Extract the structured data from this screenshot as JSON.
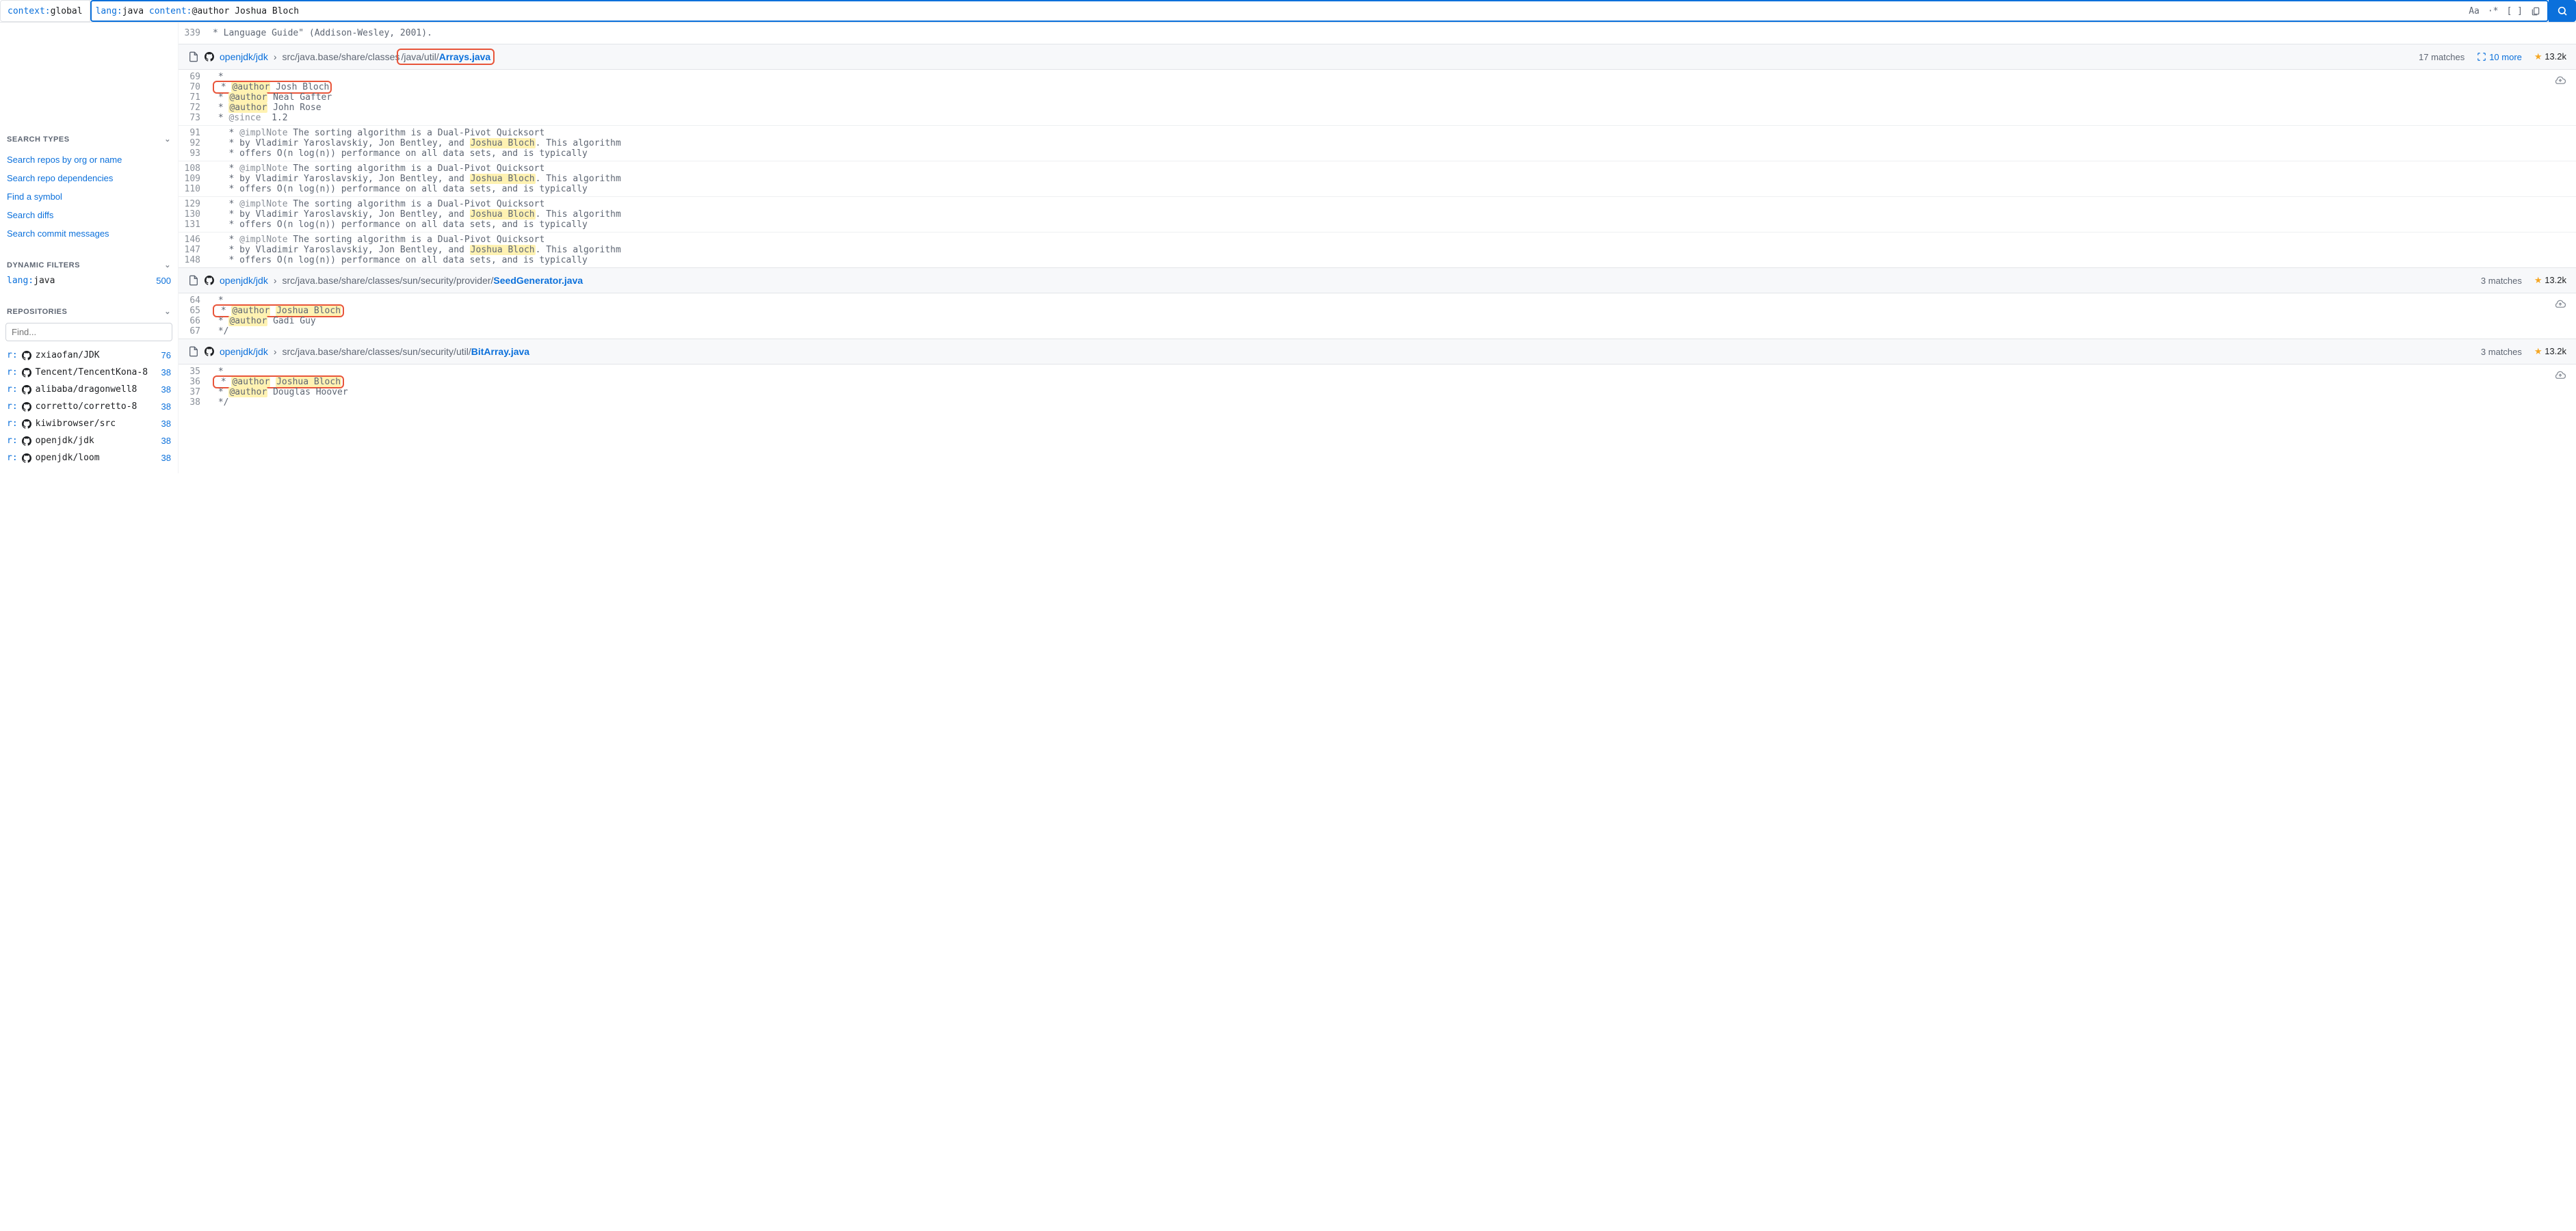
{
  "search": {
    "context_key": "context:",
    "context_val": "global",
    "query_parts": [
      {
        "k": "lang:",
        "v": "java "
      },
      {
        "k": "content:",
        "v": "@author Joshua Bloch"
      }
    ],
    "icons": {
      "case": "Aa",
      "regex": "·*",
      "struct": "[ ]",
      "clip": "📋"
    }
  },
  "sidebar": {
    "search_types": {
      "title": "Search Types",
      "links": [
        "Search repos by org or name",
        "Search repo dependencies",
        "Find a symbol",
        "Search diffs",
        "Search commit messages"
      ]
    },
    "dynamic_filters": {
      "title": "Dynamic Filters",
      "items": [
        {
          "key": "lang:",
          "val": "java",
          "count": "500"
        }
      ]
    },
    "repositories": {
      "title": "Repositories",
      "find_placeholder": "Find...",
      "items": [
        {
          "prefix": "r:",
          "name": "zxiaofan/JDK",
          "count": "76"
        },
        {
          "prefix": "r:",
          "name": "Tencent/TencentKona-8",
          "count": "38"
        },
        {
          "prefix": "r:",
          "name": "alibaba/dragonwell8",
          "count": "38"
        },
        {
          "prefix": "r:",
          "name": "corretto/corretto-8",
          "count": "38"
        },
        {
          "prefix": "r:",
          "name": "kiwibrowser/src",
          "count": "38"
        },
        {
          "prefix": "r:",
          "name": "openjdk/jdk",
          "count": "38"
        },
        {
          "prefix": "r:",
          "name": "openjdk/loom",
          "count": "38"
        }
      ]
    }
  },
  "trunc_prev": {
    "num": "339",
    "text": " * Language Guide\"  (Addison-Wesley, 2001)."
  },
  "results": [
    {
      "repo": "openjdk/jdk",
      "path": "src/java.base/share/classes",
      "path_boxed": "/java/util/",
      "file": "Arrays.java",
      "file_redbox": true,
      "matches": "17 matches",
      "more": "10 more",
      "stars": "13.2k",
      "hunks": [
        {
          "cloud": true,
          "lines": [
            {
              "n": "69",
              "segs": [
                {
                  "t": " *"
                }
              ]
            },
            {
              "n": "70",
              "redbox": true,
              "segs": [
                {
                  "t": " * "
                },
                {
                  "t": "@author",
                  "hl": true
                },
                {
                  "t": " Josh Bloch"
                }
              ]
            },
            {
              "n": "71",
              "segs": [
                {
                  "t": " * "
                },
                {
                  "t": "@author",
                  "hl": true
                },
                {
                  "t": " Neal Gafter"
                }
              ]
            },
            {
              "n": "72",
              "segs": [
                {
                  "t": " * "
                },
                {
                  "t": "@author",
                  "hl": true
                },
                {
                  "t": " John Rose"
                }
              ]
            },
            {
              "n": "73",
              "segs": [
                {
                  "t": " * "
                },
                {
                  "t": "@since",
                  "cls": "anno-tag"
                },
                {
                  "t": "  1.2"
                }
              ]
            }
          ]
        },
        {
          "lines": [
            {
              "n": "91",
              "segs": [
                {
                  "t": "   * "
                },
                {
                  "t": "@implNote",
                  "cls": "anno-tag"
                },
                {
                  "t": " The sorting algorithm is a Dual-Pivot Quicksort"
                }
              ]
            },
            {
              "n": "92",
              "segs": [
                {
                  "t": "   * by Vladimir Yaroslavskiy, Jon Bentley, and "
                },
                {
                  "t": "Joshua Bloch",
                  "hl": true
                },
                {
                  "t": ". This algorithm"
                }
              ]
            },
            {
              "n": "93",
              "segs": [
                {
                  "t": "   * offers O(n log(n)) performance on all data sets, and is typically"
                }
              ]
            }
          ]
        },
        {
          "lines": [
            {
              "n": "108",
              "segs": [
                {
                  "t": "   * "
                },
                {
                  "t": "@implNote",
                  "cls": "anno-tag"
                },
                {
                  "t": " The sorting algorithm is a Dual-Pivot Quicksort"
                }
              ]
            },
            {
              "n": "109",
              "segs": [
                {
                  "t": "   * by Vladimir Yaroslavskiy, Jon Bentley, and "
                },
                {
                  "t": "Joshua Bloch",
                  "hl": true
                },
                {
                  "t": ". This algorithm"
                }
              ]
            },
            {
              "n": "110",
              "segs": [
                {
                  "t": "   * offers O(n log(n)) performance on all data sets, and is typically"
                }
              ]
            }
          ]
        },
        {
          "lines": [
            {
              "n": "129",
              "segs": [
                {
                  "t": "   * "
                },
                {
                  "t": "@implNote",
                  "cls": "anno-tag"
                },
                {
                  "t": " The sorting algorithm is a Dual-Pivot Quicksort"
                }
              ]
            },
            {
              "n": "130",
              "segs": [
                {
                  "t": "   * by Vladimir Yaroslavskiy, Jon Bentley, and "
                },
                {
                  "t": "Joshua Bloch",
                  "hl": true
                },
                {
                  "t": ". This algorithm"
                }
              ]
            },
            {
              "n": "131",
              "segs": [
                {
                  "t": "   * offers O(n log(n)) performance on all data sets, and is typically"
                }
              ]
            }
          ]
        },
        {
          "lines": [
            {
              "n": "146",
              "segs": [
                {
                  "t": "   * "
                },
                {
                  "t": "@implNote",
                  "cls": "anno-tag"
                },
                {
                  "t": " The sorting algorithm is a Dual-Pivot Quicksort"
                }
              ]
            },
            {
              "n": "147",
              "segs": [
                {
                  "t": "   * by Vladimir Yaroslavskiy, Jon Bentley, and "
                },
                {
                  "t": "Joshua Bloch",
                  "hl": true
                },
                {
                  "t": ". This algorithm"
                }
              ]
            },
            {
              "n": "148",
              "segs": [
                {
                  "t": "   * offers O(n log(n)) performance on all data sets, and is typically"
                }
              ]
            }
          ]
        }
      ]
    },
    {
      "repo": "openjdk/jdk",
      "path": "src/java.base/share/classes/sun/security/provider/",
      "file": "SeedGenerator.java",
      "matches": "3 matches",
      "stars": "13.2k",
      "hunks": [
        {
          "cloud": true,
          "lines": [
            {
              "n": "64",
              "segs": [
                {
                  "t": " *"
                }
              ]
            },
            {
              "n": "65",
              "redbox": true,
              "segs": [
                {
                  "t": " * "
                },
                {
                  "t": "@author",
                  "hl": true
                },
                {
                  "t": " "
                },
                {
                  "t": "Joshua Bloch",
                  "hl": true
                }
              ]
            },
            {
              "n": "66",
              "segs": [
                {
                  "t": " * "
                },
                {
                  "t": "@author",
                  "hl": true
                },
                {
                  "t": " Gadi Guy"
                }
              ]
            },
            {
              "n": "67",
              "segs": [
                {
                  "t": " */"
                }
              ]
            }
          ]
        }
      ]
    },
    {
      "repo": "openjdk/jdk",
      "path": "src/java.base/share/classes/sun/security/util/",
      "file": "BitArray.java",
      "matches": "3 matches",
      "stars": "13.2k",
      "hunks": [
        {
          "cloud": true,
          "lines": [
            {
              "n": "35",
              "segs": [
                {
                  "t": " *"
                }
              ]
            },
            {
              "n": "36",
              "redbox": true,
              "segs": [
                {
                  "t": " * "
                },
                {
                  "t": "@author",
                  "hl": true
                },
                {
                  "t": " "
                },
                {
                  "t": "Joshua Bloch",
                  "hl": true
                }
              ]
            },
            {
              "n": "37",
              "segs": [
                {
                  "t": " * "
                },
                {
                  "t": "@author",
                  "hl": true
                },
                {
                  "t": " Douglas Hoover"
                }
              ]
            },
            {
              "n": "38",
              "segs": [
                {
                  "t": " */"
                }
              ]
            }
          ]
        }
      ]
    }
  ]
}
